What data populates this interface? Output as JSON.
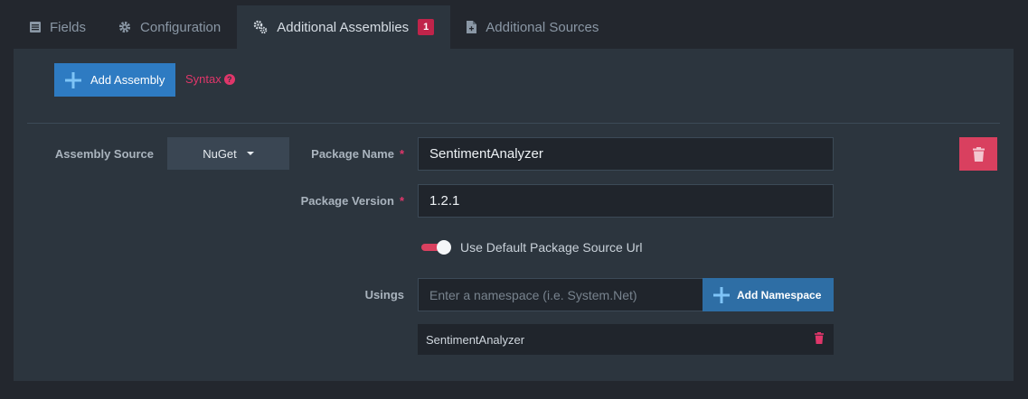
{
  "tabs": [
    {
      "label": "Fields",
      "icon": "list-icon",
      "active": false
    },
    {
      "label": "Configuration",
      "icon": "gear-icon",
      "active": false
    },
    {
      "label": "Additional Assemblies",
      "icon": "gears-icon",
      "active": true,
      "badge": "1"
    },
    {
      "label": "Additional Sources",
      "icon": "file-icon",
      "active": false
    }
  ],
  "toolbar": {
    "add_assembly_label": "Add Assembly",
    "syntax_label": "Syntax",
    "help_glyph": "?"
  },
  "form": {
    "assembly_source_label": "Assembly Source",
    "assembly_source_value": "NuGet",
    "package_name_label": "Package Name",
    "package_name_value": "SentimentAnalyzer",
    "package_version_label": "Package Version",
    "package_version_value": "1.2.1",
    "required_marker": "*",
    "toggle_label": "Use Default Package Source Url",
    "toggle_on": true,
    "usings_label": "Usings",
    "namespace_placeholder": "Enter a namespace (i.e. System.Net)",
    "add_namespace_label": "Add Namespace",
    "usings": [
      "SentimentAnalyzer"
    ]
  },
  "colors": {
    "accent_blue": "#2e7bc2",
    "danger": "#d9405f",
    "badge": "#c0244a",
    "panel": "#2c353e",
    "background": "#23272e"
  }
}
